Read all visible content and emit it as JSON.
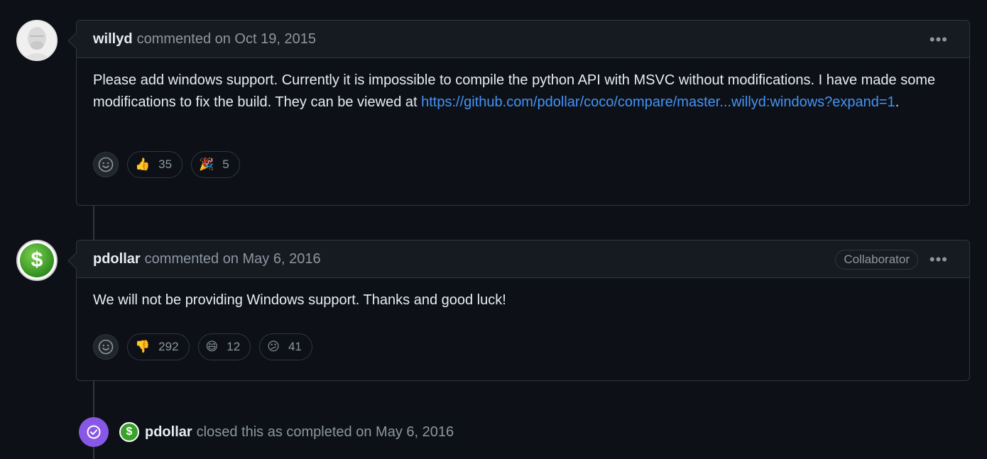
{
  "comments": [
    {
      "author": "willyd",
      "meta": "commented on Oct 19, 2015",
      "body_text": "Please add windows support. Currently it is impossible to compile the python API with MSVC without modifications. I have made some modifications to fix the build. They can be viewed at ",
      "link_text": "https://github.com/pdollar/coco/compare/master...willyd:windows?expand=1",
      "body_tail": ".",
      "reactions": [
        {
          "icon": "thumbs-up-icon",
          "emoji": "👍",
          "count": "35"
        },
        {
          "icon": "tada-icon",
          "emoji": "🎉",
          "count": "5"
        }
      ]
    },
    {
      "author": "pdollar",
      "meta": "commented on May 6, 2016",
      "badge": "Collaborator",
      "body_text": "We will not be providing Windows support. Thanks and good luck!",
      "reactions": [
        {
          "icon": "thumbs-down-icon",
          "emoji": "👎",
          "count": "292"
        },
        {
          "icon": "laugh-icon",
          "emoji": "😄",
          "count": "12"
        },
        {
          "icon": "confused-icon",
          "emoji": "😕",
          "count": "41"
        }
      ]
    }
  ],
  "closed_event": {
    "author": "pdollar",
    "text": "closed this as completed on May 6, 2016"
  },
  "avatar_dollar": "$",
  "kebab": "•••",
  "colors": {
    "background": "#0d1117",
    "link": "#4493f8",
    "closed_purple": "#8957e5",
    "avatar_green": "#3aa12a"
  }
}
